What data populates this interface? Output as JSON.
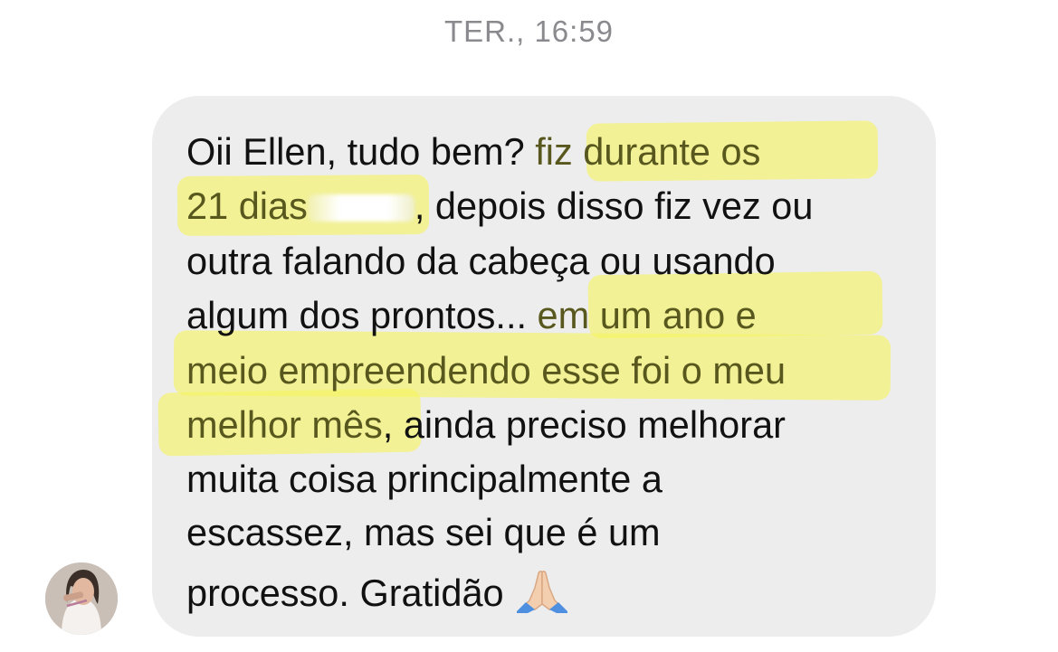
{
  "header": {
    "timestamp": "TER., 16:59"
  },
  "message": {
    "sender_avatar": "avatar-photo",
    "lines": [
      {
        "plain": "Oii Ellen, tudo bem? ",
        "highlight": "fiz durante os"
      },
      {
        "highlight": "21 dias",
        "after_redaction": ", depois disso fiz vez ou"
      },
      {
        "plain": "outra falando da cabeça ou usando"
      },
      {
        "plain": "algum dos prontos... ",
        "highlight": "em um ano e"
      },
      {
        "highlight": "meio empreendendo esse foi o meu"
      },
      {
        "highlight": "melhor mês",
        "plain": ", ainda preciso melhorar"
      },
      {
        "plain": "muita coisa principalmente a"
      },
      {
        "plain": "escassez, mas sei que é um"
      },
      {
        "plain": "processo. Gratidão"
      }
    ],
    "emoji": "folded-hands-icon",
    "highlight_color": "#f6f45f"
  }
}
